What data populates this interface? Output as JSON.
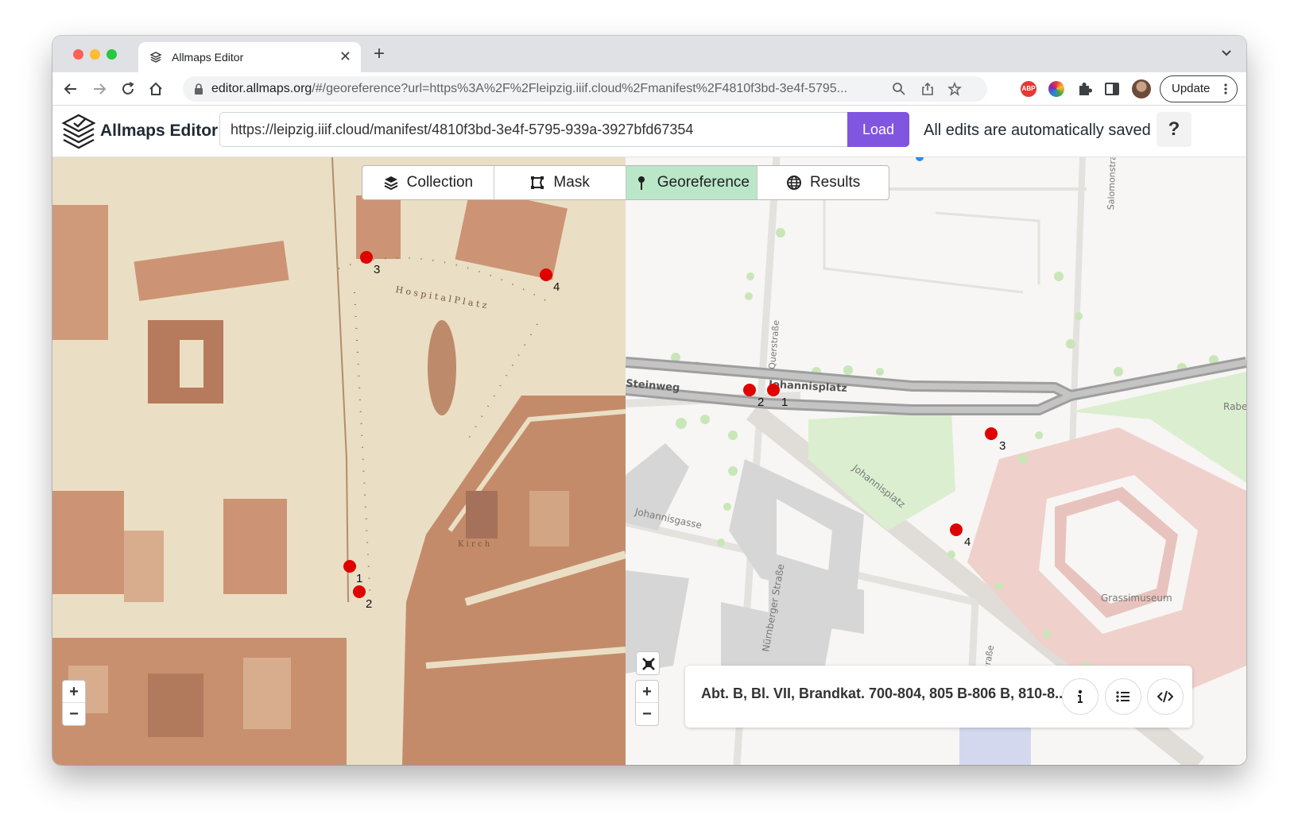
{
  "browser": {
    "tab_title": "Allmaps Editor",
    "url_host": "editor.allmaps.org",
    "url_rest": "/#/georeference?url=https%3A%2F%2Fleipzig.iiif.cloud%2Fmanifest%2F4810f3bd-3e4f-5795...",
    "update_label": "Update",
    "abp_label": "ABP"
  },
  "header": {
    "app_title": "Allmaps Editor",
    "manifest_url": "https://leipzig.iiif.cloud/manifest/4810f3bd-3e4f-5795-939a-3927bfd67354",
    "load_label": "Load",
    "saved_text": "All edits are automatically saved",
    "help_label": "?"
  },
  "modes": [
    {
      "label": "Collection",
      "icon": "layers-icon",
      "active": false
    },
    {
      "label": "Mask",
      "icon": "mask-icon",
      "active": false
    },
    {
      "label": "Georeference",
      "icon": "pin-icon",
      "active": true
    },
    {
      "label": "Results",
      "icon": "globe-icon",
      "active": false
    }
  ],
  "left_map": {
    "gcps": [
      "3",
      "4",
      "1",
      "2"
    ],
    "text": {
      "square": "H o s p i t a l   P l a t z",
      "kirch": "K i r c h"
    }
  },
  "right_map": {
    "gcps": [
      "2",
      "1",
      "3",
      "4"
    ],
    "streets": {
      "johannisplatz": "Johannisplatz",
      "johannisplatz_diag": "Johannisplatz",
      "steinweg": "Steinweg",
      "querstrasse": "Querstraße",
      "johannisgasse": "Johannisgasse",
      "nurnberger": "Nürnberger Straße",
      "salomonstr": "Salomonstraße",
      "grassimuseum": "Grassimuseum",
      "rabe": "Rabe",
      "strasse_bottom": "Straße"
    }
  },
  "zoom": {
    "in": "+",
    "out": "−"
  },
  "info": {
    "title": "Abt. B, Bl. VII, Brandkat. 700-804, 805 B-806 B, 810-8..."
  },
  "colors": {
    "accent": "#8055e0",
    "active_tab": "#b9e7c8",
    "gcp": "#e00000"
  }
}
